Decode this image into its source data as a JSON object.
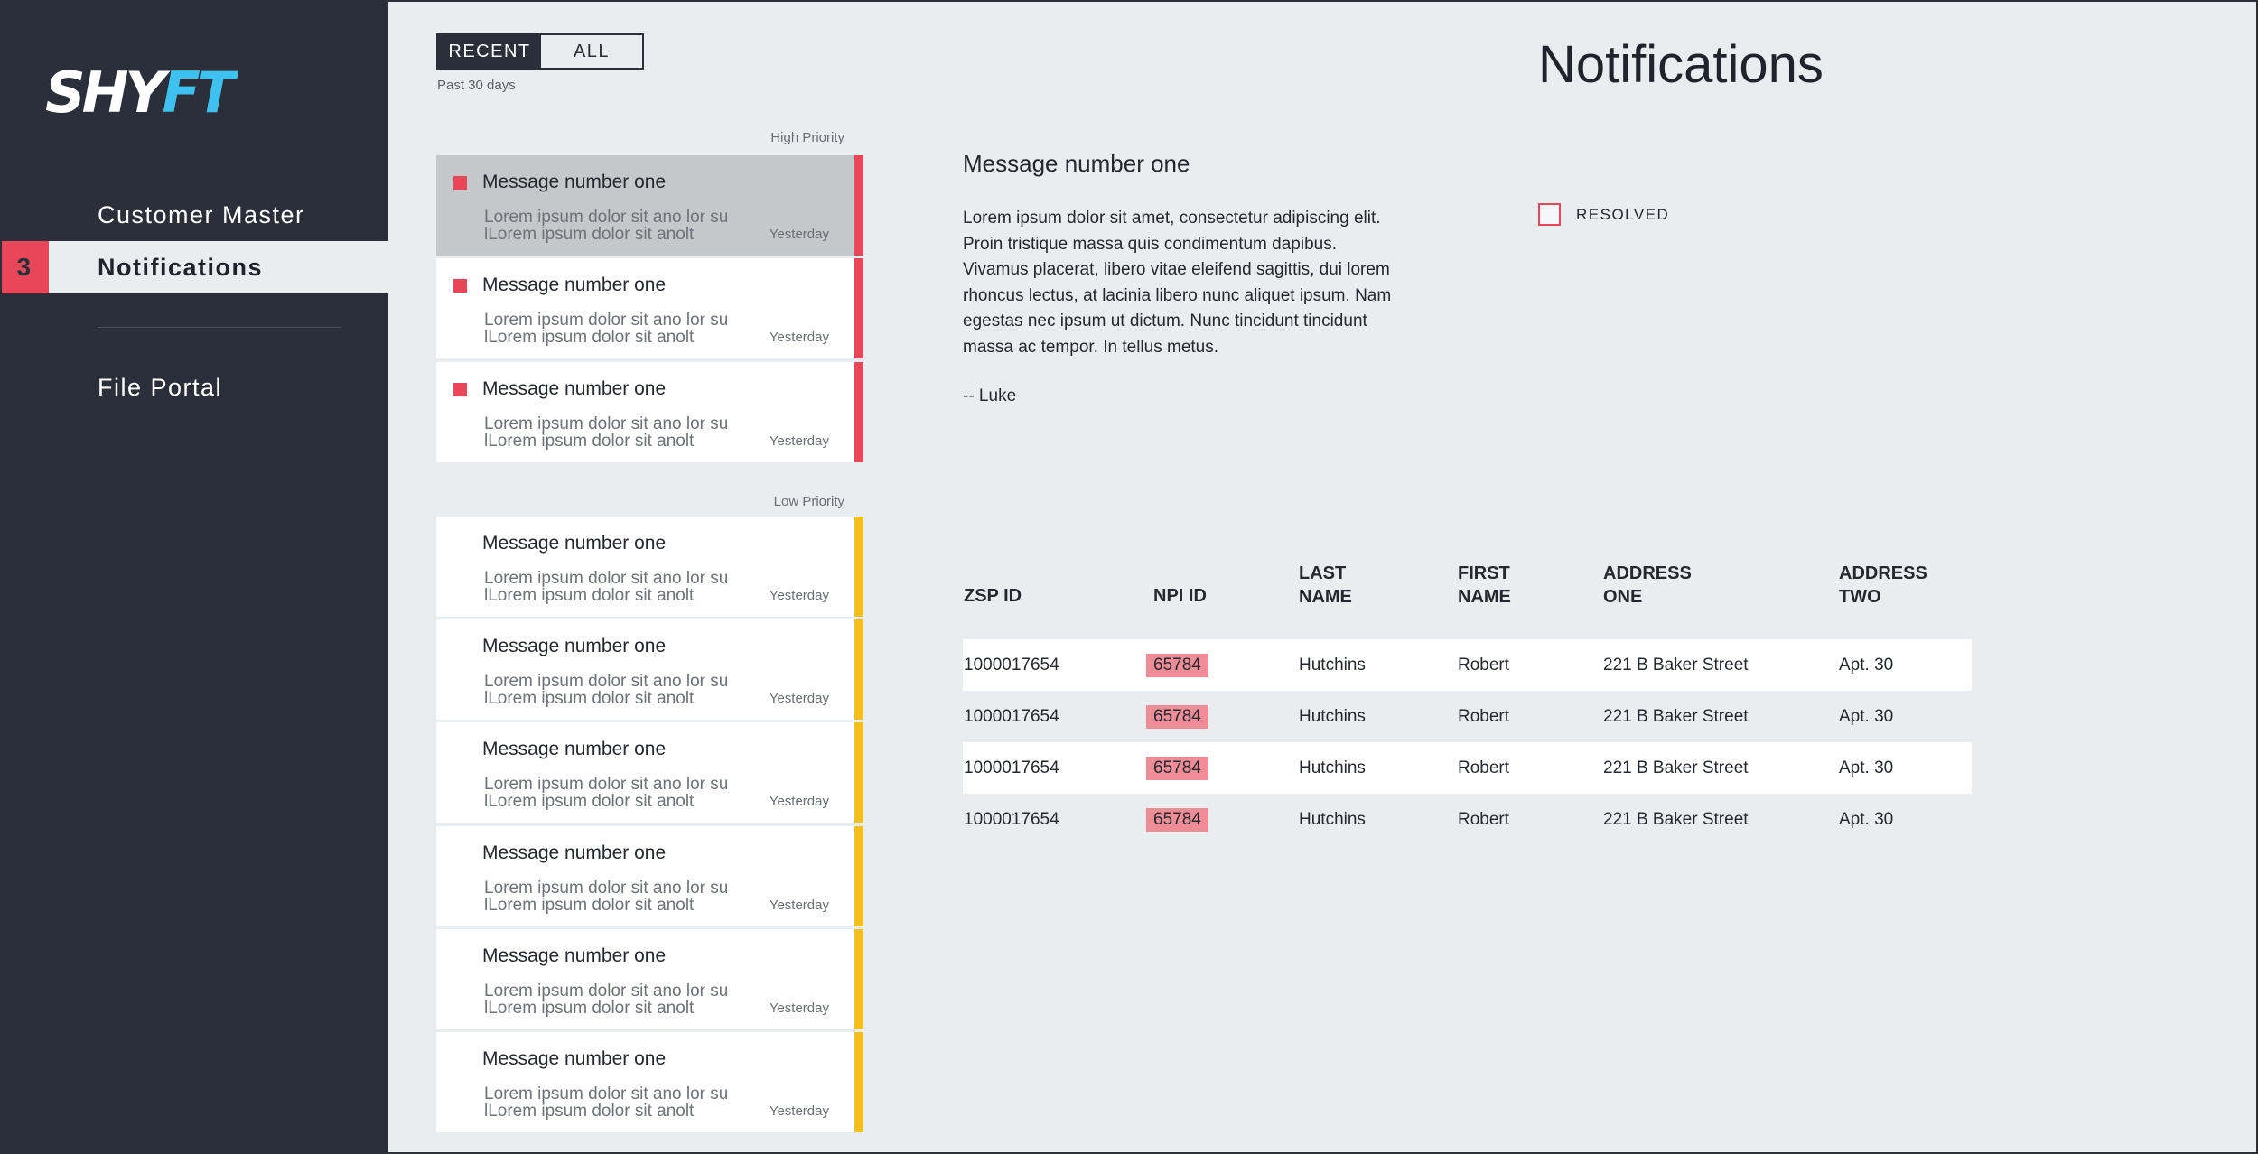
{
  "brand": {
    "logo_part1": "SHY",
    "logo_part2": "FT",
    "accent": "#3ec1ee"
  },
  "sidebar": {
    "items": [
      {
        "label": "Customer Master"
      },
      {
        "label": "Notifications",
        "badge": "3"
      },
      {
        "label": "File Portal"
      }
    ]
  },
  "filters": {
    "recent": "RECENT",
    "all": "ALL",
    "range": "Past 30 days"
  },
  "groups": {
    "high": "High Priority",
    "low": "Low Priority"
  },
  "messages": {
    "high": [
      {
        "title": "Message number one",
        "preview1": "Lorem ipsum dolor sit ano lor su",
        "preview2": "lLorem ipsum dolor sit anolt",
        "time": "Yesterday"
      },
      {
        "title": "Message number one",
        "preview1": "Lorem ipsum dolor sit ano lor su",
        "preview2": "lLorem ipsum dolor sit anolt",
        "time": "Yesterday"
      },
      {
        "title": "Message number one",
        "preview1": "Lorem ipsum dolor sit ano lor su",
        "preview2": "lLorem ipsum dolor sit anolt",
        "time": "Yesterday"
      }
    ],
    "low": [
      {
        "title": "Message number one",
        "preview1": "Lorem ipsum dolor sit ano lor su",
        "preview2": "lLorem ipsum dolor sit anolt",
        "time": "Yesterday"
      },
      {
        "title": "Message number one",
        "preview1": "Lorem ipsum dolor sit ano lor su",
        "preview2": "lLorem ipsum dolor sit anolt",
        "time": "Yesterday"
      },
      {
        "title": "Message number one",
        "preview1": "Lorem ipsum dolor sit ano lor su",
        "preview2": "lLorem ipsum dolor sit anolt",
        "time": "Yesterday"
      },
      {
        "title": "Message number one",
        "preview1": "Lorem ipsum dolor sit ano lor su",
        "preview2": "lLorem ipsum dolor sit anolt",
        "time": "Yesterday"
      },
      {
        "title": "Message number one",
        "preview1": "Lorem ipsum dolor sit ano lor su",
        "preview2": "lLorem ipsum dolor sit anolt",
        "time": "Yesterday"
      },
      {
        "title": "Message number one",
        "preview1": "Lorem ipsum dolor sit ano lor su",
        "preview2": "lLorem ipsum dolor sit anolt",
        "time": "Yesterday"
      }
    ]
  },
  "detail": {
    "page_title": "Notifications",
    "title": "Message number one",
    "body": "Lorem ipsum dolor sit amet, consectetur adipiscing elit. Proin tristique massa quis condimentum dapibus. Vivamus placerat, libero vitae eleifend sagittis, dui lorem rhoncus lectus, at lacinia libero nunc aliquet ipsum. Nam egestas nec ipsum ut dictum. Nunc tincidunt tincidunt massa ac tempor. In tellus metus.",
    "signature": "-- Luke",
    "resolved_label": "RESOLVED"
  },
  "table": {
    "headers": [
      {
        "line1": "ZSP ID",
        "line2": ""
      },
      {
        "line1": "NPI ID",
        "line2": ""
      },
      {
        "line1": "LAST",
        "line2": "NAME"
      },
      {
        "line1": "FIRST",
        "line2": "NAME"
      },
      {
        "line1": "ADDRESS",
        "line2": "ONE"
      },
      {
        "line1": "ADDRESS",
        "line2": "TWO"
      }
    ],
    "rows": [
      [
        "1000017654",
        "65784",
        "Hutchins",
        "Robert",
        "221 B Baker Street",
        "Apt. 30"
      ],
      [
        "1000017654",
        "65784",
        "Hutchins",
        "Robert",
        "221 B Baker Street",
        "Apt. 30"
      ],
      [
        "1000017654",
        "65784",
        "Hutchins",
        "Robert",
        "221 B Baker Street",
        "Apt. 30"
      ],
      [
        "1000017654",
        "65784",
        "Hutchins",
        "Robert",
        "221 B Baker Street",
        "Apt. 30"
      ]
    ]
  },
  "colors": {
    "sidebar": "#2b2f39",
    "high_priority": "#e8475a",
    "low_priority": "#f3bf1e",
    "background": "#e9edf0"
  }
}
